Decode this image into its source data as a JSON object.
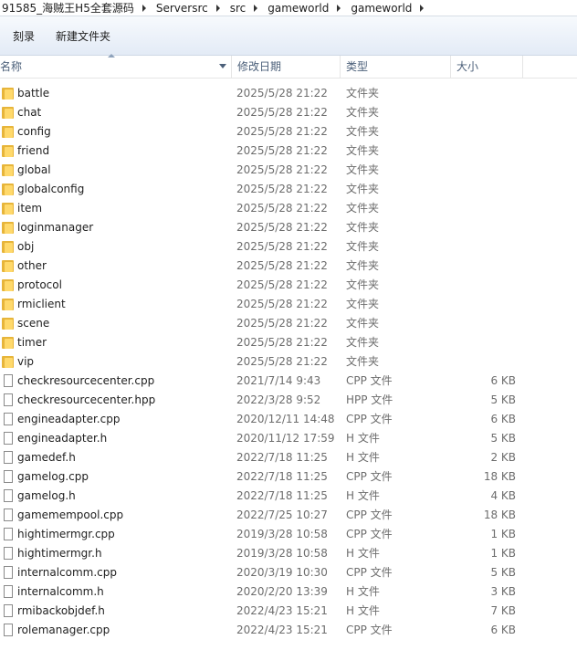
{
  "breadcrumb": [
    "91585_海贼王H5全套源码",
    "Serversrc",
    "src",
    "gameworld",
    "gameworld"
  ],
  "toolbar": {
    "burn_label": "刻录",
    "new_folder_label": "新建文件夹"
  },
  "columns": {
    "name": "名称",
    "date": "修改日期",
    "type": "类型",
    "size": "大小"
  },
  "files": [
    {
      "name": "battle",
      "date": "2025/5/28 21:22",
      "type": "文件夹",
      "size": "",
      "icon": "folder-icon"
    },
    {
      "name": "chat",
      "date": "2025/5/28 21:22",
      "type": "文件夹",
      "size": "",
      "icon": "folder-icon"
    },
    {
      "name": "config",
      "date": "2025/5/28 21:22",
      "type": "文件夹",
      "size": "",
      "icon": "folder-icon"
    },
    {
      "name": "friend",
      "date": "2025/5/28 21:22",
      "type": "文件夹",
      "size": "",
      "icon": "folder-icon"
    },
    {
      "name": "global",
      "date": "2025/5/28 21:22",
      "type": "文件夹",
      "size": "",
      "icon": "folder-icon"
    },
    {
      "name": "globalconfig",
      "date": "2025/5/28 21:22",
      "type": "文件夹",
      "size": "",
      "icon": "folder-icon"
    },
    {
      "name": "item",
      "date": "2025/5/28 21:22",
      "type": "文件夹",
      "size": "",
      "icon": "folder-icon"
    },
    {
      "name": "loginmanager",
      "date": "2025/5/28 21:22",
      "type": "文件夹",
      "size": "",
      "icon": "folder-icon"
    },
    {
      "name": "obj",
      "date": "2025/5/28 21:22",
      "type": "文件夹",
      "size": "",
      "icon": "folder-icon"
    },
    {
      "name": "other",
      "date": "2025/5/28 21:22",
      "type": "文件夹",
      "size": "",
      "icon": "folder-icon"
    },
    {
      "name": "protocol",
      "date": "2025/5/28 21:22",
      "type": "文件夹",
      "size": "",
      "icon": "folder-icon"
    },
    {
      "name": "rmiclient",
      "date": "2025/5/28 21:22",
      "type": "文件夹",
      "size": "",
      "icon": "folder-icon"
    },
    {
      "name": "scene",
      "date": "2025/5/28 21:22",
      "type": "文件夹",
      "size": "",
      "icon": "folder-icon"
    },
    {
      "name": "timer",
      "date": "2025/5/28 21:22",
      "type": "文件夹",
      "size": "",
      "icon": "folder-icon"
    },
    {
      "name": "vip",
      "date": "2025/5/28 21:22",
      "type": "文件夹",
      "size": "",
      "icon": "folder-icon"
    },
    {
      "name": "checkresourcecenter.cpp",
      "date": "2021/7/14 9:43",
      "type": "CPP 文件",
      "size": "6 KB",
      "icon": "file-icon"
    },
    {
      "name": "checkresourcecenter.hpp",
      "date": "2022/3/28 9:52",
      "type": "HPP 文件",
      "size": "5 KB",
      "icon": "file-icon"
    },
    {
      "name": "engineadapter.cpp",
      "date": "2020/12/11 14:48",
      "type": "CPP 文件",
      "size": "6 KB",
      "icon": "file-icon"
    },
    {
      "name": "engineadapter.h",
      "date": "2020/11/12 17:59",
      "type": "H 文件",
      "size": "5 KB",
      "icon": "file-icon"
    },
    {
      "name": "gamedef.h",
      "date": "2022/7/18 11:25",
      "type": "H 文件",
      "size": "2 KB",
      "icon": "file-icon"
    },
    {
      "name": "gamelog.cpp",
      "date": "2022/7/18 11:25",
      "type": "CPP 文件",
      "size": "18 KB",
      "icon": "file-icon"
    },
    {
      "name": "gamelog.h",
      "date": "2022/7/18 11:25",
      "type": "H 文件",
      "size": "4 KB",
      "icon": "file-icon"
    },
    {
      "name": "gamemempool.cpp",
      "date": "2022/7/25 10:27",
      "type": "CPP 文件",
      "size": "18 KB",
      "icon": "file-icon"
    },
    {
      "name": "hightimermgr.cpp",
      "date": "2019/3/28 10:58",
      "type": "CPP 文件",
      "size": "1 KB",
      "icon": "file-icon"
    },
    {
      "name": "hightimermgr.h",
      "date": "2019/3/28 10:58",
      "type": "H 文件",
      "size": "1 KB",
      "icon": "file-icon"
    },
    {
      "name": "internalcomm.cpp",
      "date": "2020/3/19 10:30",
      "type": "CPP 文件",
      "size": "5 KB",
      "icon": "file-icon"
    },
    {
      "name": "internalcomm.h",
      "date": "2020/2/20 13:39",
      "type": "H 文件",
      "size": "3 KB",
      "icon": "file-icon"
    },
    {
      "name": "rmibackobjdef.h",
      "date": "2022/4/23 15:21",
      "type": "H 文件",
      "size": "7 KB",
      "icon": "file-icon"
    },
    {
      "name": "rolemanager.cpp",
      "date": "2022/4/23 15:21",
      "type": "CPP 文件",
      "size": "6 KB",
      "icon": "file-icon"
    }
  ]
}
